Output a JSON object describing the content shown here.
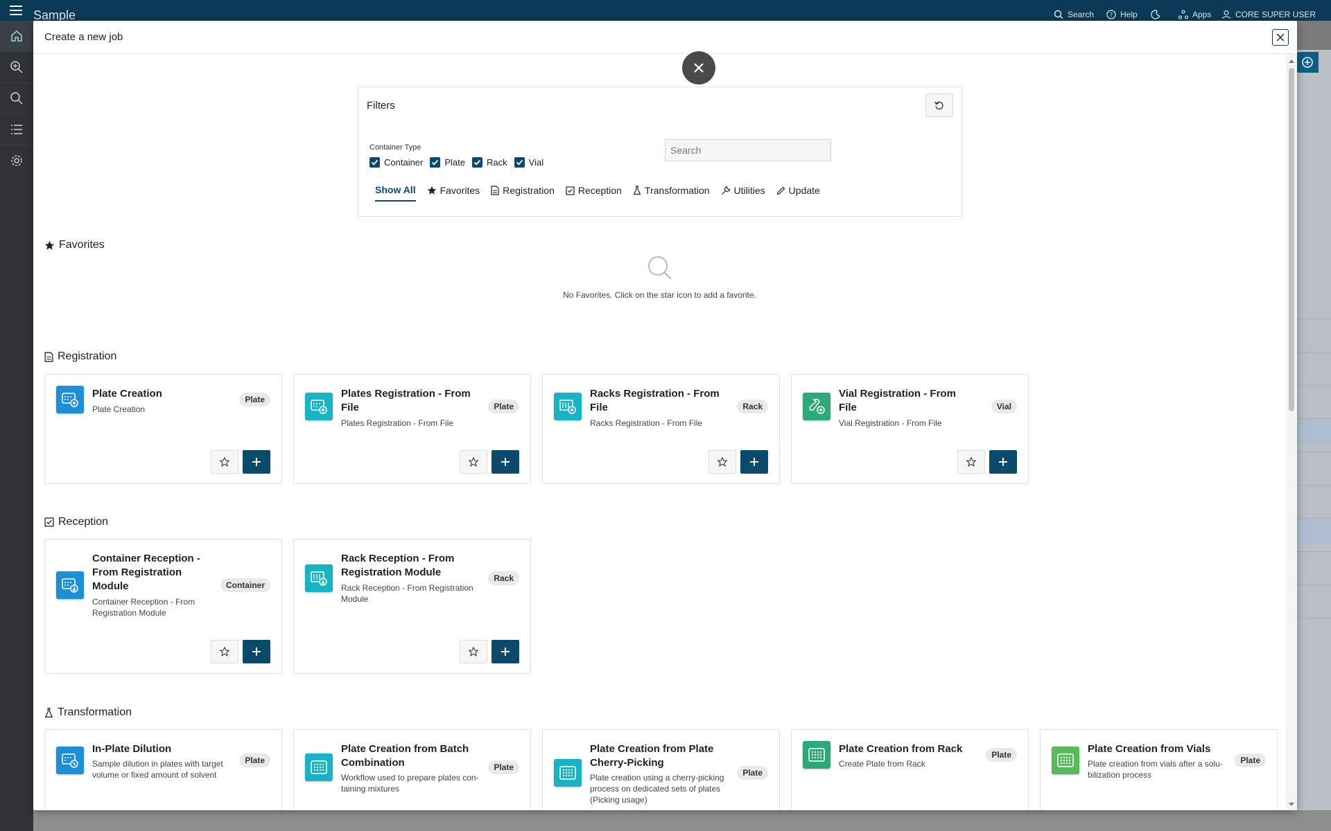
{
  "app": {
    "brand": "Sample",
    "header_search": "Search",
    "header_help": "Help",
    "header_apps": "Apps",
    "header_user": "CORE SUPER USER"
  },
  "modal": {
    "title": "Create a new job"
  },
  "filters": {
    "title": "Filters",
    "container_type_label": "Container Type",
    "checkboxes": [
      "Container",
      "Plate",
      "Rack",
      "Vial"
    ],
    "search_placeholder": "Search",
    "tabs": [
      "Show All",
      "Favorites",
      "Registration",
      "Reception",
      "Transformation",
      "Utilities",
      "Update"
    ]
  },
  "favorites": {
    "title": "Favorites",
    "empty_text": "No Favorites. Click on the star icon to add a favorite."
  },
  "registration": {
    "title": "Registration",
    "cards": [
      {
        "title": "Plate Creation",
        "desc": "Plate Creation",
        "badge": "Plate"
      },
      {
        "title": "Plates Registration - From File",
        "desc": "Plates Registration - From File",
        "badge": "Plate"
      },
      {
        "title": "Racks Registration - From File",
        "desc": "Racks Registration - From File",
        "badge": "Rack"
      },
      {
        "title": "Vial Registration - From File",
        "desc": "Vial Registration - From File",
        "badge": "Vial"
      }
    ]
  },
  "reception": {
    "title": "Reception",
    "cards": [
      {
        "title": "Container Reception - From Registration Module",
        "desc": "Container Reception - From Registration Module",
        "badge": "Container"
      },
      {
        "title": "Rack Reception - From Registration Module",
        "desc": "Rack Reception - From Registration Module",
        "badge": "Rack"
      }
    ]
  },
  "transformation": {
    "title": "Transformation",
    "cards": [
      {
        "title": "In-Plate Dilution",
        "desc": "Sample dilution in plates with target volume or fixed amount of solvent",
        "badge": "Plate"
      },
      {
        "title": "Plate Creation from Batch Combination",
        "desc": "Workflow used to prepare plates con-taining mixtures",
        "badge": "Plate"
      },
      {
        "title": "Plate Creation from Plate Cherry-Picking",
        "desc": "Plate creation using a cherry-picking process on dedicated sets of plates (Picking usage)",
        "badge": "Plate"
      },
      {
        "title": "Plate Creation from Rack",
        "desc": "Create Plate from Rack",
        "badge": "Plate"
      },
      {
        "title": "Plate Creation from Vials",
        "desc": "Plate creation from vials after a solu-bilization process",
        "badge": "Plate"
      }
    ]
  },
  "colors": {
    "primary": "#0b4a6b",
    "topbar": "#0b3a56",
    "sidebar": "#2f3337",
    "icon_blue": "#1e8fd6",
    "icon_teal": "#19b3c4",
    "icon_green": "#2ea879",
    "icon_lightgreen": "#5bb85d"
  }
}
